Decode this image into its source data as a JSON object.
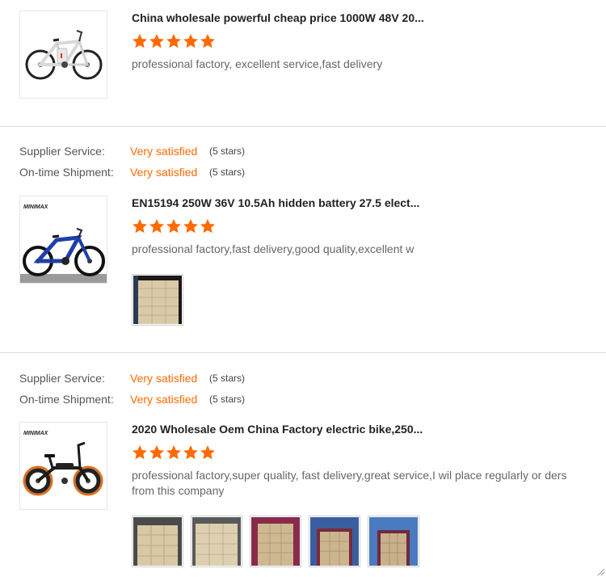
{
  "star_color": "#ff6a00",
  "reviews": [
    {
      "product_title": "China wholesale powerful cheap price 1000W 48V 20...",
      "stars": 5,
      "text": "professional factory, excellent service,fast delivery"
    },
    {
      "ratings": [
        {
          "label": "Supplier Service:",
          "value": "Very satisfied",
          "stars_text": "(5 stars)"
        },
        {
          "label": "On-time Shipment:",
          "value": "Very satisfied",
          "stars_text": "(5 stars)"
        }
      ],
      "brand_logo": "MINIMAX",
      "product_title": "EN15194 250W 36V 10.5Ah hidden battery 27.5 elect...",
      "stars": 5,
      "text": "professional factory,fast delivery,good quality,excellent w"
    },
    {
      "ratings": [
        {
          "label": "Supplier Service:",
          "value": "Very satisfied",
          "stars_text": "(5 stars)"
        },
        {
          "label": "On-time Shipment:",
          "value": "Very satisfied",
          "stars_text": "(5 stars)"
        }
      ],
      "brand_logo": "MINIMAX",
      "product_title": "2020 Wholesale Oem China Factory electric bike,250...",
      "stars": 5,
      "text": "professional factory,super quality, fast delivery,great service,I wil place regularly or ders from this company"
    }
  ]
}
